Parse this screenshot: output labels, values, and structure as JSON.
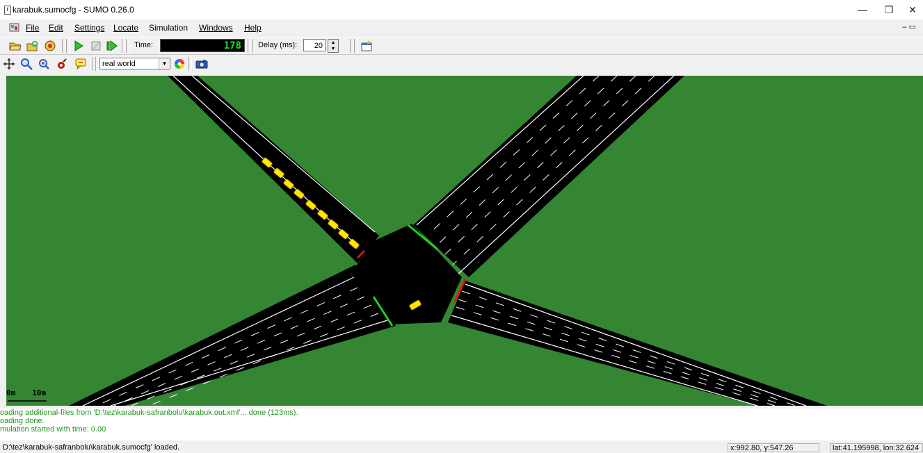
{
  "window": {
    "title": "karabuk.sumocfg - SUMO 0.26.0",
    "minimize": "—",
    "restore": "❐",
    "close": "✕"
  },
  "menu": {
    "items": [
      {
        "label": "File"
      },
      {
        "label": "Edit"
      },
      {
        "label": "Settings"
      },
      {
        "label": "Locate"
      },
      {
        "label": "Simulation"
      },
      {
        "label": "Windows"
      },
      {
        "label": "Help"
      }
    ],
    "mdi_buttons": "– ▭"
  },
  "toolbar": {
    "time_label": "Time:",
    "time_value": "178",
    "delay_label": "Delay (ms):",
    "delay_value": "20"
  },
  "view_toolbar": {
    "scheme_select": "real world"
  },
  "canvas": {
    "scale_left": "0m",
    "scale_right": "10m",
    "colors": {
      "grass": "#348633",
      "road": "#000000",
      "lane_marking": "#ffffff",
      "signal_green": "#1fd11f",
      "signal_red": "#e01414",
      "vehicle": "#ffe800"
    }
  },
  "messages": [
    "oading additional-files from 'D:\\tez\\karabuk-safranbolu\\karabuk.out.xml'... done (123ms).",
    "oading done.",
    "mulation started with time: 0.00"
  ],
  "status": {
    "message": "D:\\tez\\karabuk-safranbolu\\karabuk.sumocfg' loaded.",
    "coords": "x:992.80, y:547.26",
    "geo": "lat:41.195998, lon:32.624"
  }
}
